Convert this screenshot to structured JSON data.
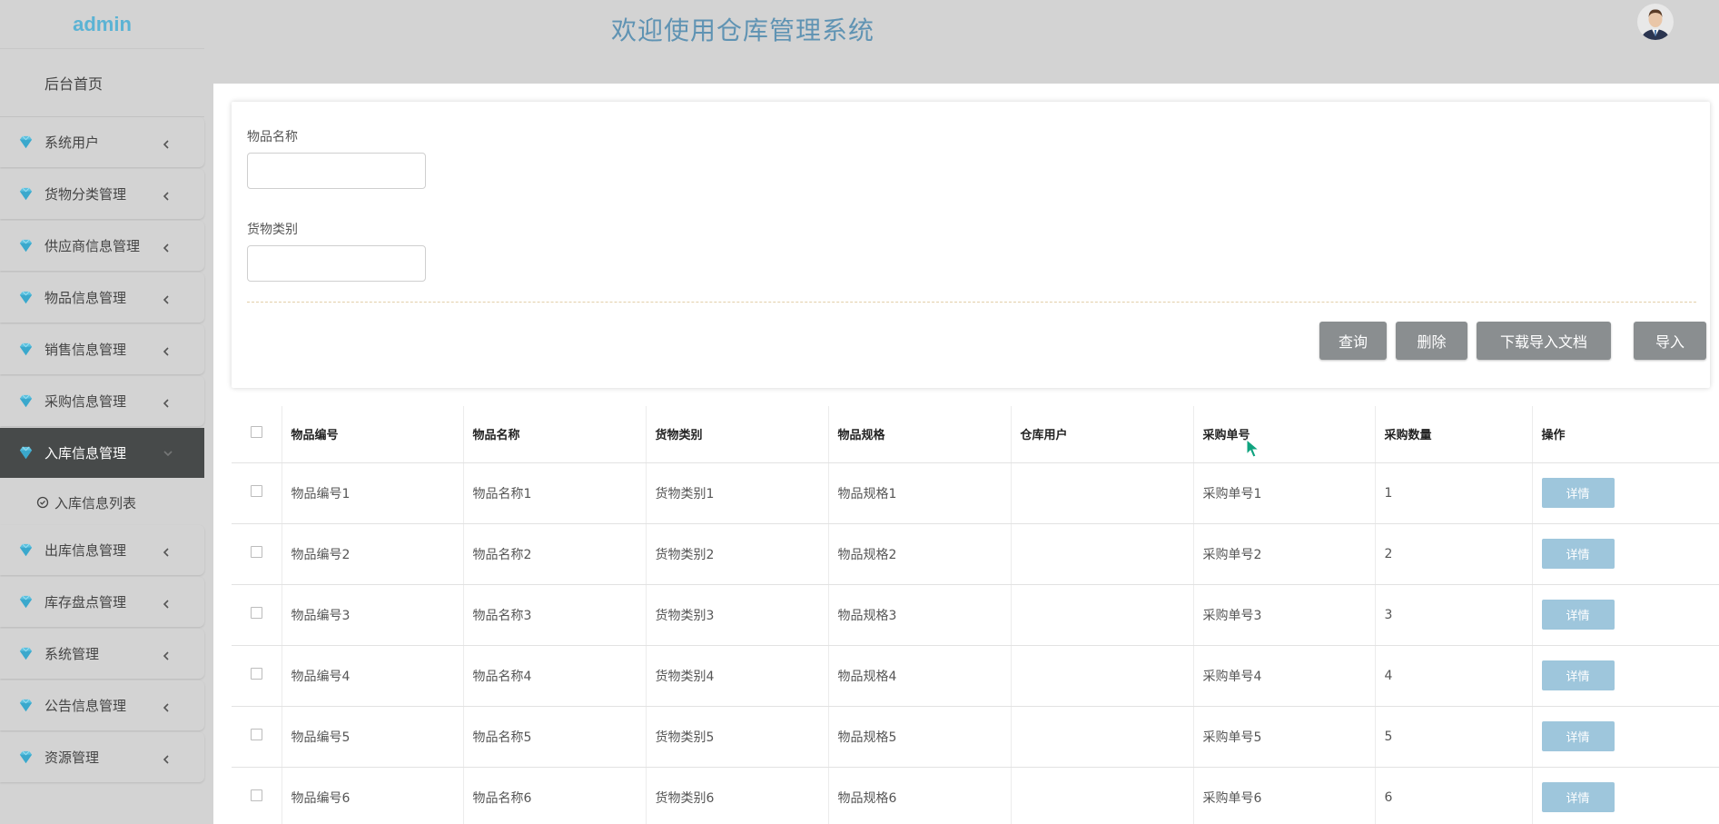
{
  "sidebar": {
    "brand": "admin",
    "home": "后台首页",
    "items": [
      {
        "label": "系统用户"
      },
      {
        "label": "货物分类管理"
      },
      {
        "label": "供应商信息管理"
      },
      {
        "label": "物品信息管理"
      },
      {
        "label": "销售信息管理"
      },
      {
        "label": "采购信息管理"
      },
      {
        "label": "入库信息管理"
      },
      {
        "label": "出库信息管理"
      },
      {
        "label": "库存盘点管理"
      },
      {
        "label": "系统管理"
      },
      {
        "label": "公告信息管理"
      },
      {
        "label": "资源管理"
      }
    ],
    "active_index": 6,
    "sub_item": "入库信息列表"
  },
  "header": {
    "title": "欢迎使用仓库管理系统"
  },
  "search": {
    "field1_label": "物品名称",
    "field1_value": "",
    "field2_label": "货物类别",
    "field2_value": "",
    "buttons": [
      "查询",
      "删除",
      "下载导入文档",
      "导入"
    ]
  },
  "table": {
    "columns": [
      "物品编号",
      "物品名称",
      "货物类别",
      "物品规格",
      "仓库用户",
      "采购单号",
      "采购数量",
      "操作"
    ],
    "rows": [
      [
        "物品编号1",
        "物品名称1",
        "货物类别1",
        "物品规格1",
        "",
        "采购单号1",
        "1"
      ],
      [
        "物品编号2",
        "物品名称2",
        "货物类别2",
        "物品规格2",
        "",
        "采购单号2",
        "2"
      ],
      [
        "物品编号3",
        "物品名称3",
        "货物类别3",
        "物品规格3",
        "",
        "采购单号3",
        "3"
      ],
      [
        "物品编号4",
        "物品名称4",
        "货物类别4",
        "物品规格4",
        "",
        "采购单号4",
        "4"
      ],
      [
        "物品编号5",
        "物品名称5",
        "货物类别5",
        "物品规格5",
        "",
        "采购单号5",
        "5"
      ],
      [
        "物品编号6",
        "物品名称6",
        "货物类别6",
        "物品规格6",
        "",
        "采购单号6",
        "6"
      ]
    ],
    "action_label": "详情"
  },
  "colors": {
    "accent": "#5f93b3",
    "brand": "#5bb3d4",
    "active_menu_bg": "#474a4a",
    "button_gray": "#8a8e90",
    "detail_button": "#9ec6dc",
    "gem_icon": "#5bc0de"
  },
  "icons": {
    "menu_icon": "diamond-icon",
    "chevron": "chevron-left-icon",
    "sub_icon": "check-circle-icon"
  }
}
